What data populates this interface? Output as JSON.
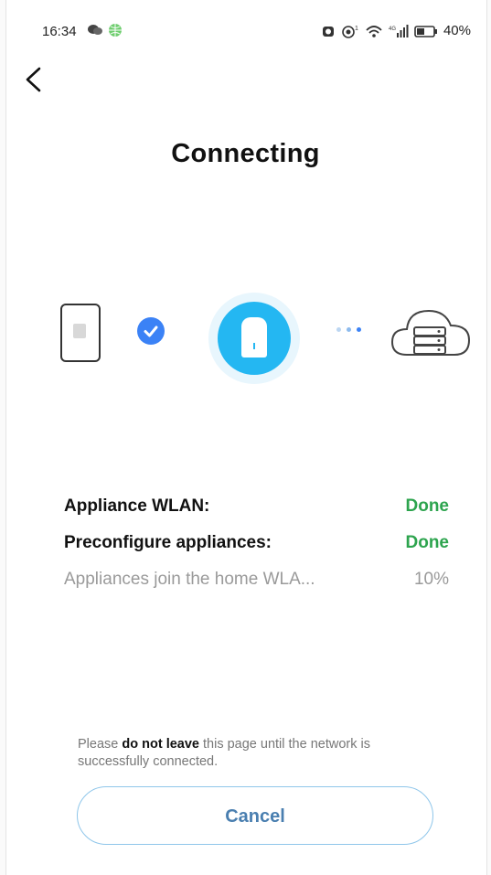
{
  "status_bar": {
    "time": "16:34",
    "battery": "40%",
    "icons": [
      "chat-bubble-icon",
      "globe-icon",
      "alarm-icon",
      "nfc-icon",
      "wifi-icon",
      "signal-icon",
      "battery-icon"
    ]
  },
  "header": {
    "back_icon": "chevron-left-icon",
    "title": "Connecting"
  },
  "flow": {
    "nodes": [
      "phone-icon",
      "check-circle-icon",
      "appliance-icon",
      "progress-dots-icon",
      "cloud-server-icon"
    ],
    "colors": {
      "check": "#3b82f6",
      "appliance": "#24b7f2",
      "appliance_ring": "#e8f6fd"
    }
  },
  "steps": [
    {
      "label": "Appliance WLAN:",
      "status": "Done"
    },
    {
      "label": "Preconfigure appliances:",
      "status": "Done"
    },
    {
      "label": "Appliances join the home WLA...",
      "status": "10%"
    }
  ],
  "notice": {
    "prefix": "Please ",
    "emphasis": "do not leave",
    "suffix": " this page until the network is successfully connected."
  },
  "cancel_label": "Cancel",
  "colors": {
    "done": "#2da44e",
    "pending": "#9a9a9a",
    "cancel_text": "#4a7fb0",
    "cancel_border": "#8fc6ea"
  }
}
